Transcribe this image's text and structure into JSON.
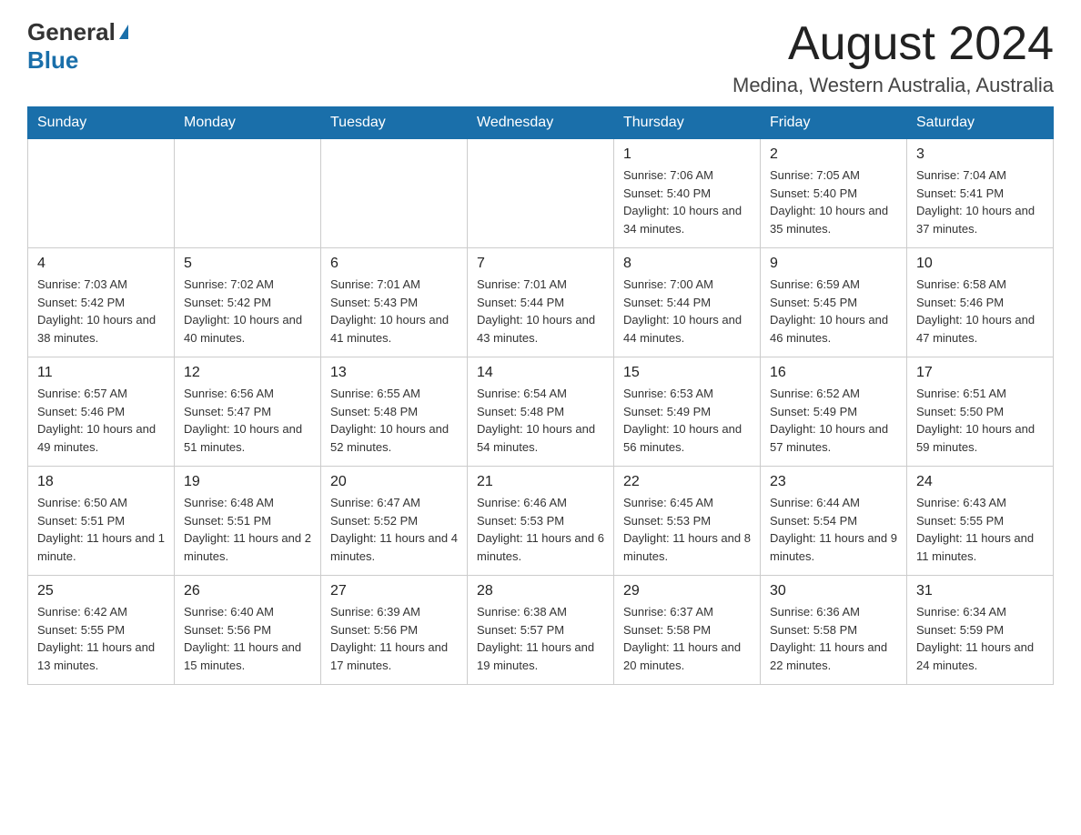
{
  "header": {
    "logo_general": "General",
    "logo_blue": "Blue",
    "month_title": "August 2024",
    "location": "Medina, Western Australia, Australia"
  },
  "weekdays": [
    "Sunday",
    "Monday",
    "Tuesday",
    "Wednesday",
    "Thursday",
    "Friday",
    "Saturday"
  ],
  "weeks": [
    [
      {
        "day": "",
        "info": ""
      },
      {
        "day": "",
        "info": ""
      },
      {
        "day": "",
        "info": ""
      },
      {
        "day": "",
        "info": ""
      },
      {
        "day": "1",
        "info": "Sunrise: 7:06 AM\nSunset: 5:40 PM\nDaylight: 10 hours and 34 minutes."
      },
      {
        "day": "2",
        "info": "Sunrise: 7:05 AM\nSunset: 5:40 PM\nDaylight: 10 hours and 35 minutes."
      },
      {
        "day": "3",
        "info": "Sunrise: 7:04 AM\nSunset: 5:41 PM\nDaylight: 10 hours and 37 minutes."
      }
    ],
    [
      {
        "day": "4",
        "info": "Sunrise: 7:03 AM\nSunset: 5:42 PM\nDaylight: 10 hours and 38 minutes."
      },
      {
        "day": "5",
        "info": "Sunrise: 7:02 AM\nSunset: 5:42 PM\nDaylight: 10 hours and 40 minutes."
      },
      {
        "day": "6",
        "info": "Sunrise: 7:01 AM\nSunset: 5:43 PM\nDaylight: 10 hours and 41 minutes."
      },
      {
        "day": "7",
        "info": "Sunrise: 7:01 AM\nSunset: 5:44 PM\nDaylight: 10 hours and 43 minutes."
      },
      {
        "day": "8",
        "info": "Sunrise: 7:00 AM\nSunset: 5:44 PM\nDaylight: 10 hours and 44 minutes."
      },
      {
        "day": "9",
        "info": "Sunrise: 6:59 AM\nSunset: 5:45 PM\nDaylight: 10 hours and 46 minutes."
      },
      {
        "day": "10",
        "info": "Sunrise: 6:58 AM\nSunset: 5:46 PM\nDaylight: 10 hours and 47 minutes."
      }
    ],
    [
      {
        "day": "11",
        "info": "Sunrise: 6:57 AM\nSunset: 5:46 PM\nDaylight: 10 hours and 49 minutes."
      },
      {
        "day": "12",
        "info": "Sunrise: 6:56 AM\nSunset: 5:47 PM\nDaylight: 10 hours and 51 minutes."
      },
      {
        "day": "13",
        "info": "Sunrise: 6:55 AM\nSunset: 5:48 PM\nDaylight: 10 hours and 52 minutes."
      },
      {
        "day": "14",
        "info": "Sunrise: 6:54 AM\nSunset: 5:48 PM\nDaylight: 10 hours and 54 minutes."
      },
      {
        "day": "15",
        "info": "Sunrise: 6:53 AM\nSunset: 5:49 PM\nDaylight: 10 hours and 56 minutes."
      },
      {
        "day": "16",
        "info": "Sunrise: 6:52 AM\nSunset: 5:49 PM\nDaylight: 10 hours and 57 minutes."
      },
      {
        "day": "17",
        "info": "Sunrise: 6:51 AM\nSunset: 5:50 PM\nDaylight: 10 hours and 59 minutes."
      }
    ],
    [
      {
        "day": "18",
        "info": "Sunrise: 6:50 AM\nSunset: 5:51 PM\nDaylight: 11 hours and 1 minute."
      },
      {
        "day": "19",
        "info": "Sunrise: 6:48 AM\nSunset: 5:51 PM\nDaylight: 11 hours and 2 minutes."
      },
      {
        "day": "20",
        "info": "Sunrise: 6:47 AM\nSunset: 5:52 PM\nDaylight: 11 hours and 4 minutes."
      },
      {
        "day": "21",
        "info": "Sunrise: 6:46 AM\nSunset: 5:53 PM\nDaylight: 11 hours and 6 minutes."
      },
      {
        "day": "22",
        "info": "Sunrise: 6:45 AM\nSunset: 5:53 PM\nDaylight: 11 hours and 8 minutes."
      },
      {
        "day": "23",
        "info": "Sunrise: 6:44 AM\nSunset: 5:54 PM\nDaylight: 11 hours and 9 minutes."
      },
      {
        "day": "24",
        "info": "Sunrise: 6:43 AM\nSunset: 5:55 PM\nDaylight: 11 hours and 11 minutes."
      }
    ],
    [
      {
        "day": "25",
        "info": "Sunrise: 6:42 AM\nSunset: 5:55 PM\nDaylight: 11 hours and 13 minutes."
      },
      {
        "day": "26",
        "info": "Sunrise: 6:40 AM\nSunset: 5:56 PM\nDaylight: 11 hours and 15 minutes."
      },
      {
        "day": "27",
        "info": "Sunrise: 6:39 AM\nSunset: 5:56 PM\nDaylight: 11 hours and 17 minutes."
      },
      {
        "day": "28",
        "info": "Sunrise: 6:38 AM\nSunset: 5:57 PM\nDaylight: 11 hours and 19 minutes."
      },
      {
        "day": "29",
        "info": "Sunrise: 6:37 AM\nSunset: 5:58 PM\nDaylight: 11 hours and 20 minutes."
      },
      {
        "day": "30",
        "info": "Sunrise: 6:36 AM\nSunset: 5:58 PM\nDaylight: 11 hours and 22 minutes."
      },
      {
        "day": "31",
        "info": "Sunrise: 6:34 AM\nSunset: 5:59 PM\nDaylight: 11 hours and 24 minutes."
      }
    ]
  ]
}
